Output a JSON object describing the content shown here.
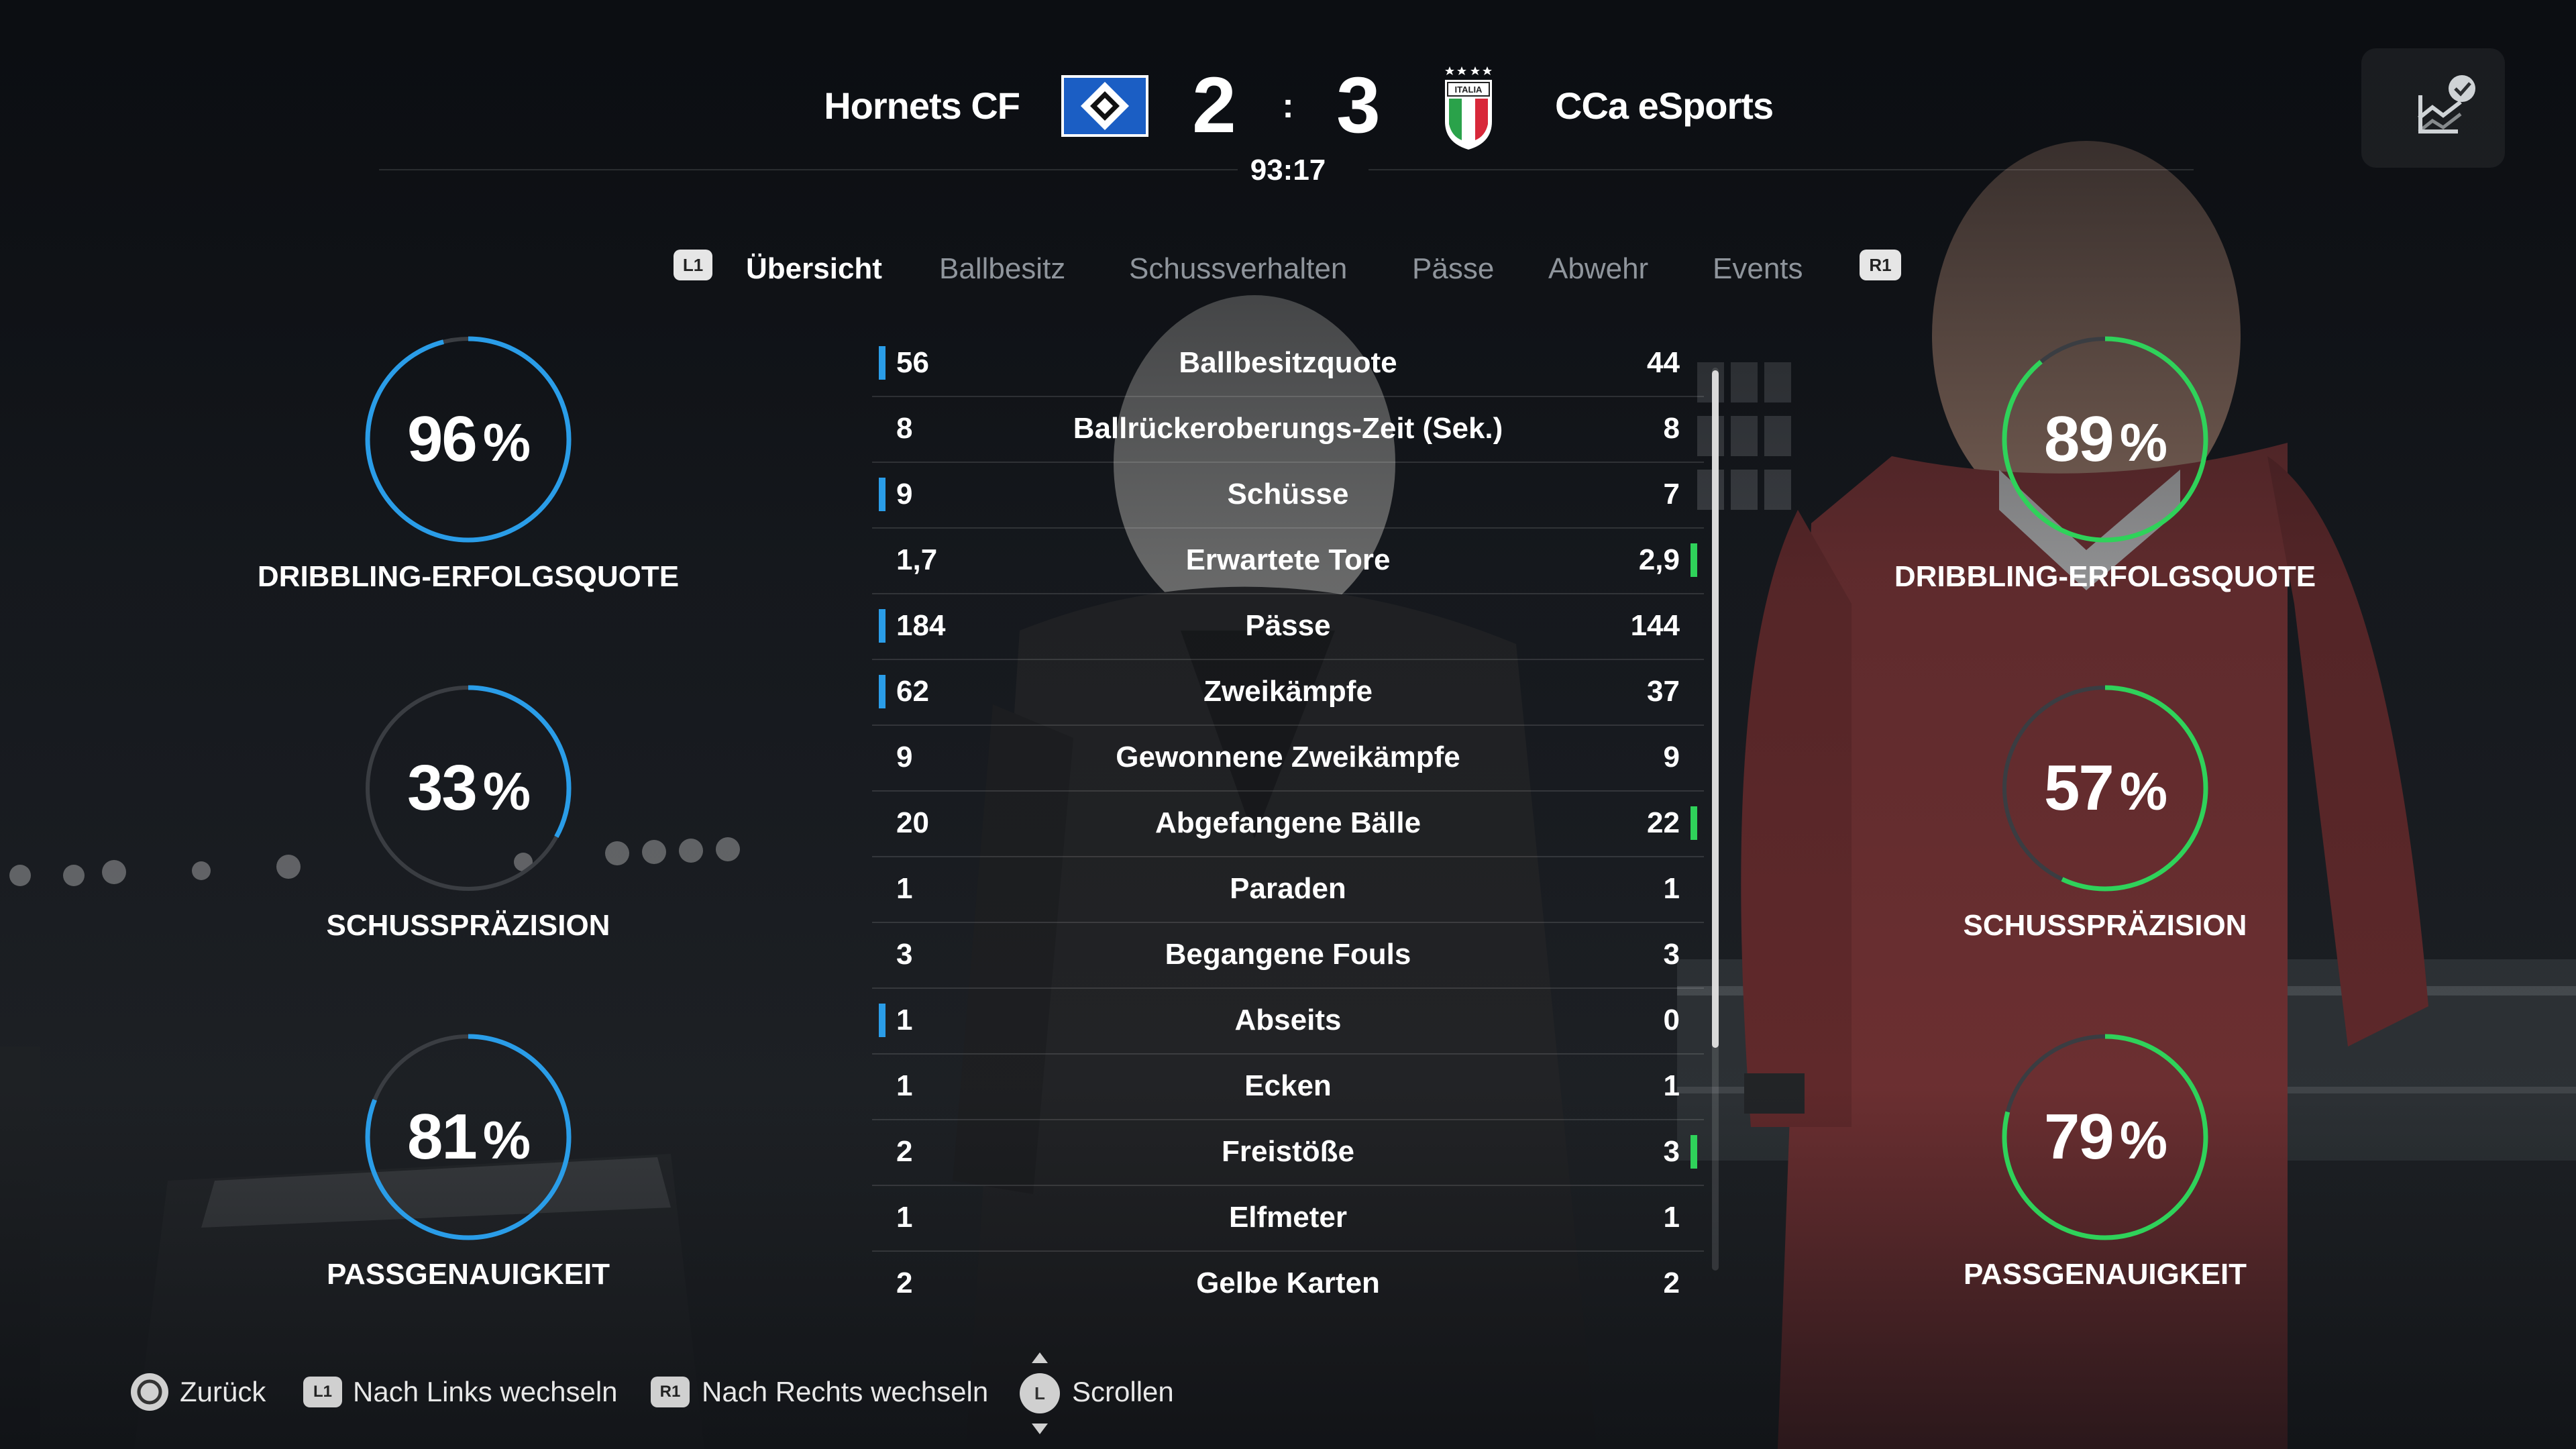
{
  "header": {
    "home": {
      "name": "Hornets CF",
      "score": "2"
    },
    "away": {
      "name": "CCa eSports",
      "score": "3"
    },
    "separator": ":",
    "time": "93:17",
    "away_crest_text": "ITALIA"
  },
  "tabs": {
    "prev_badge": "L1",
    "next_badge": "R1",
    "items": [
      "Übersicht",
      "Ballbesitz",
      "Schussverhalten",
      "Pässe",
      "Abwehr",
      "Events"
    ],
    "active": "Übersicht"
  },
  "rings": {
    "home": [
      {
        "value": "96",
        "unit": "%",
        "label": "DRIBBLING-ERFOLGSQUOTE",
        "fraction": 0.96
      },
      {
        "value": "33",
        "unit": "%",
        "label": "SCHUSSPRÄZISION",
        "fraction": 0.33
      },
      {
        "value": "81",
        "unit": "%",
        "label": "PASSGENAUIGKEIT",
        "fraction": 0.81
      }
    ],
    "away": [
      {
        "value": "89",
        "unit": "%",
        "label": "DRIBBLING-ERFOLGSQUOTE",
        "fraction": 0.89
      },
      {
        "value": "57",
        "unit": "%",
        "label": "SCHUSSPRÄZISION",
        "fraction": 0.57
      },
      {
        "value": "79",
        "unit": "%",
        "label": "PASSGENAUIGKEIT",
        "fraction": 0.79
      }
    ]
  },
  "stats": [
    {
      "home": "56",
      "label": "Ballbesitzquote",
      "away": "44",
      "lead": "home"
    },
    {
      "home": "8",
      "label": "Ballrückeroberungs-Zeit (Sek.)",
      "away": "8",
      "lead": ""
    },
    {
      "home": "9",
      "label": "Schüsse",
      "away": "7",
      "lead": "home"
    },
    {
      "home": "1,7",
      "label": "Erwartete Tore",
      "away": "2,9",
      "lead": "away"
    },
    {
      "home": "184",
      "label": "Pässe",
      "away": "144",
      "lead": "home"
    },
    {
      "home": "62",
      "label": "Zweikämpfe",
      "away": "37",
      "lead": "home"
    },
    {
      "home": "9",
      "label": "Gewonnene Zweikämpfe",
      "away": "9",
      "lead": ""
    },
    {
      "home": "20",
      "label": "Abgefangene Bälle",
      "away": "22",
      "lead": "away"
    },
    {
      "home": "1",
      "label": "Paraden",
      "away": "1",
      "lead": ""
    },
    {
      "home": "3",
      "label": "Begangene Fouls",
      "away": "3",
      "lead": ""
    },
    {
      "home": "1",
      "label": "Abseits",
      "away": "0",
      "lead": "home"
    },
    {
      "home": "1",
      "label": "Ecken",
      "away": "1",
      "lead": ""
    },
    {
      "home": "2",
      "label": "Freistöße",
      "away": "3",
      "lead": "away"
    },
    {
      "home": "1",
      "label": "Elfmeter",
      "away": "1",
      "lead": ""
    },
    {
      "home": "2",
      "label": "Gelbe Karten",
      "away": "2",
      "lead": ""
    }
  ],
  "footer": {
    "back": "Zurück",
    "l1_badge": "L1",
    "left": "Nach Links wechseln",
    "r1_badge": "R1",
    "right": "Nach Rechts wechseln",
    "stick_badge": "L",
    "scroll": "Scrollen"
  },
  "colors": {
    "home_accent": "#2a9de8",
    "away_accent": "#2fd25a",
    "ring_track": "#3a3d42",
    "hamburg_blue": "#1b5ec4"
  },
  "icons": {
    "stats_button": "chart-check-icon",
    "back": "circle-button-icon",
    "scroll": "left-stick-icon"
  }
}
